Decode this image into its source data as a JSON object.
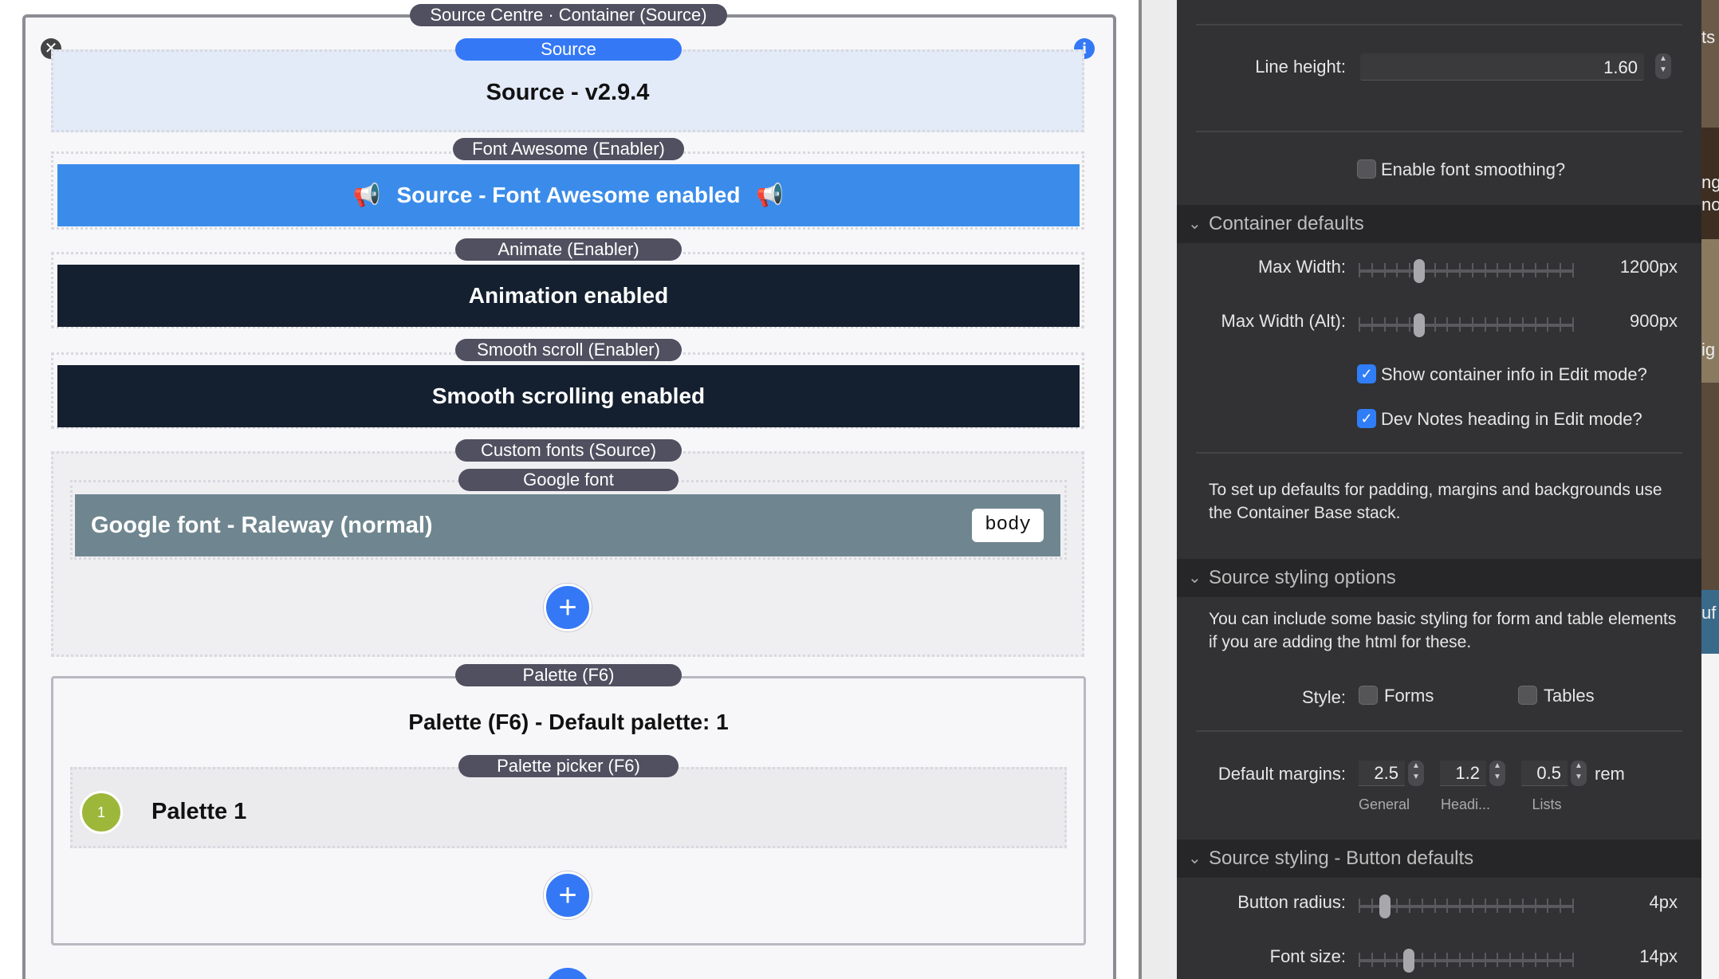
{
  "canvas": {
    "outer_label": "Source Centre · Container (Source)",
    "source": {
      "label": "Source",
      "title": "Source - v2.9.4"
    },
    "fontawesome": {
      "label": "Font Awesome (Enabler)",
      "text": "Source - Font Awesome enabled",
      "icon": "bullhorn-icon"
    },
    "animate": {
      "label": "Animate (Enabler)",
      "text": "Animation enabled"
    },
    "smooth": {
      "label": "Smooth scroll (Enabler)",
      "text": "Smooth scrolling enabled"
    },
    "custom_fonts": {
      "label": "Custom fonts (Source)",
      "google_label": "Google font",
      "google_text": "Google font - Raleway (normal)",
      "tag": "body",
      "add": "+"
    },
    "palette": {
      "label": "Palette (F6)",
      "title": "Palette (F6) - Default palette: 1",
      "picker_label": "Palette picker (F6)",
      "swatch_number": "1",
      "item": "Palette 1",
      "swatch_color": "#9cb73a",
      "add": "+"
    },
    "colors": {
      "accent": "#3478f6",
      "dark_bar": "#14202f",
      "font_bar": "#6f8690",
      "source_bg": "#e3eaf8"
    }
  },
  "panel": {
    "line_height": {
      "label": "Line height:",
      "value": "1.60"
    },
    "font_smoothing": {
      "label": "Enable font smoothing?",
      "checked": false
    },
    "container_defaults": {
      "title": "Container defaults",
      "max_width": {
        "label": "Max Width:",
        "value": "1200px",
        "level": 0.27
      },
      "max_width_alt": {
        "label": "Max Width (Alt):",
        "value": "900px",
        "level": 0.27
      },
      "show_info": {
        "label": "Show container info in Edit mode?",
        "checked": true
      },
      "dev_notes": {
        "label": "Dev Notes heading in Edit mode?",
        "checked": true
      },
      "note": "To set up defaults for padding, margins and backgrounds use the Container Base stack."
    },
    "styling_options": {
      "title": "Source styling options",
      "text": "You can include some basic styling for form and table elements if you are adding the html for these.",
      "style_label": "Style:",
      "forms": "Forms",
      "tables": "Tables",
      "margins_label": "Default margins:",
      "general": "2.5",
      "headings": "1.2",
      "lists": "0.5",
      "unit": "rem",
      "general_cap": "General",
      "headings_cap": "Headi...",
      "lists_cap": "Lists"
    },
    "button_defaults": {
      "title": "Source styling - Button defaults",
      "radius": {
        "label": "Button radius:",
        "value": "4px",
        "level": 0.1
      },
      "font_size": {
        "label": "Font size:",
        "value": "14px",
        "level": 0.22
      }
    },
    "colors": {
      "bg": "#323234",
      "header_bg": "#262628",
      "checkbox_on": "#2f7df7"
    }
  },
  "edge": {
    "f1": "ts",
    "f2": "ng",
    "f3": "no",
    "f4": "ig",
    "f5": "uf"
  }
}
